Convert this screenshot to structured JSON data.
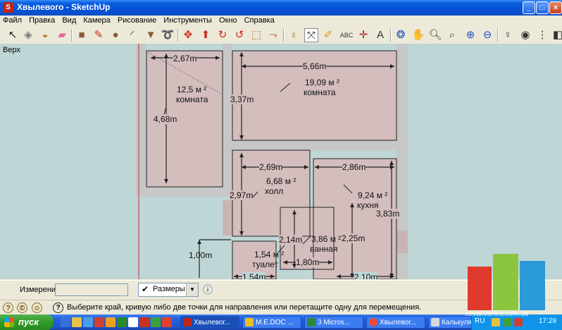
{
  "window": {
    "title": "Хвылевого - SketchUp",
    "buttons": {
      "minimize": "_",
      "maximize": "□",
      "close": "×"
    }
  },
  "menu": [
    "Файл",
    "Правка",
    "Вид",
    "Камера",
    "Рисование",
    "Инструменты",
    "Окно",
    "Справка"
  ],
  "toolbar": {
    "icons": [
      "select-tool-icon",
      "component-tool-icon",
      "paint-bucket-icon",
      "eraser-icon",
      "rectangle-tool-icon",
      "pencil-line-icon",
      "circle-tool-icon",
      "arc-tool-icon",
      "polygon-tool-icon",
      "freehand-tool-icon",
      "move-tool-icon",
      "push-pull-icon",
      "rotate-tool-icon",
      "follow-me-icon",
      "scale-tool-icon",
      "offset-tool-icon",
      "tape-measure-icon",
      "dimension-tool-icon",
      "protractor-icon",
      "text-tool-icon",
      "axes-tool-icon",
      "3d-text-icon",
      "orbit-tool-icon",
      "pan-tool-icon",
      "zoom-tool-icon",
      "zoom-window-icon",
      "zoom-extents-icon",
      "previous-view-icon",
      "position-camera-icon",
      "look-around-icon",
      "walk-tool-icon",
      "section-plane-icon"
    ]
  },
  "canvas": {
    "view_label": "Верх",
    "rooms": [
      {
        "area": "12,5 м ²",
        "name": "комната"
      },
      {
        "area": "19,09 м ²",
        "name": "комната"
      },
      {
        "area": "6,68 м ²",
        "name": "холл"
      },
      {
        "area": "9,24 м ²",
        "name": "кухня"
      },
      {
        "area": "3,86 м ²",
        "name": "ванная"
      },
      {
        "area": "1,54 м ²",
        "name": "туалет"
      }
    ],
    "dimensions": [
      "2,67m",
      "5,66m",
      "4,68m",
      "3,37m",
      "2,69m",
      "2,86m",
      "2,97m",
      "3,83m",
      "2,14m",
      "2,25m",
      "1,00m",
      "1,80m",
      "1,54m",
      "2,10m"
    ]
  },
  "measurements": {
    "label": "Измерения",
    "value": "",
    "dropdown_value": "Размеры"
  },
  "status": {
    "text": "Выберите край, кривую либо две точки для направления или перетащите одну для перемещения."
  },
  "taskbar": {
    "start_label": "пуск",
    "tasks": [
      "Хвылевог...",
      "M.E.DOC ...",
      "3 Micros...",
      "Хвылевог...",
      "Калькуля..."
    ],
    "language": "RU",
    "clock": "17:29"
  },
  "watermark": {
    "text": "novakvartira.com.ua"
  },
  "colors": {
    "room_fill": "#d3bdbd",
    "gutter": "#c7c7c7",
    "background": "#bfd6d6",
    "titlebar": "#0450d6"
  }
}
